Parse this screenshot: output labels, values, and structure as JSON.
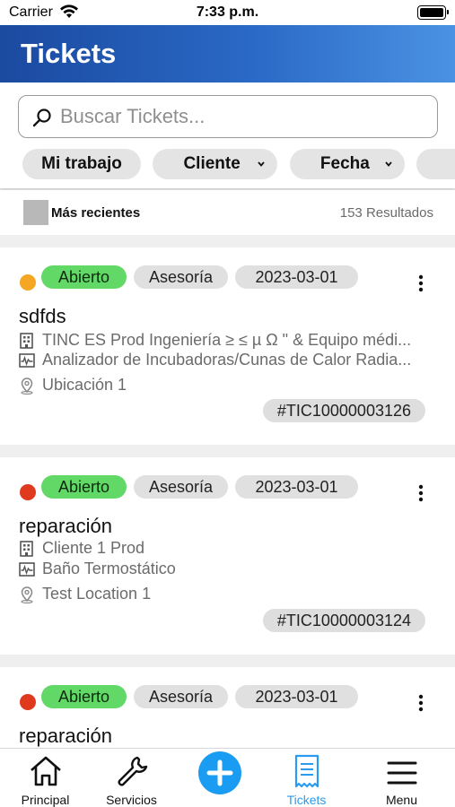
{
  "status_bar": {
    "carrier": "Carrier",
    "time": "7:33 p.m."
  },
  "header": {
    "title": "Tickets"
  },
  "search": {
    "placeholder": "Buscar Tickets..."
  },
  "filters": [
    {
      "label": "Mi trabajo"
    },
    {
      "label": "Cliente"
    },
    {
      "label": "Fecha"
    }
  ],
  "sort": {
    "label": "Más recientes",
    "results": "153 Resultados"
  },
  "tickets": [
    {
      "status_color": "#f5a623",
      "state": "Abierto",
      "category": "Asesoría",
      "date": "2023-03-01",
      "title": "sdfds",
      "client": "TINC ES Prod Ingeniería ≥ ≤ µ Ω \" & Equipo médi...",
      "equipment": "Analizador de Incubadoras/Cunas de Calor Radia...",
      "location": "Ubicación 1",
      "code": "#TIC10000003126"
    },
    {
      "status_color": "#e03a1e",
      "state": "Abierto",
      "category": "Asesoría",
      "date": "2023-03-01",
      "title": "reparación",
      "client": "Cliente 1 Prod",
      "equipment": "Baño Termostático",
      "location": "Test Location 1",
      "code": "#TIC10000003124"
    },
    {
      "status_color": "#e03a1e",
      "state": "Abierto",
      "category": "Asesoría",
      "date": "2023-03-01",
      "title": "reparación"
    }
  ],
  "tabbar": [
    {
      "label": "Principal",
      "icon": "home-icon"
    },
    {
      "label": "Servicios",
      "icon": "wrench-icon"
    },
    {
      "label": "",
      "icon": "add-icon"
    },
    {
      "label": "Tickets",
      "icon": "ticket-icon"
    },
    {
      "label": "Menu",
      "icon": "menu-icon"
    }
  ],
  "colors": {
    "accent": "#1a9cf2",
    "header_start": "#1b4aa0",
    "header_end": "#4b92e3",
    "open_badge": "#62d867"
  }
}
